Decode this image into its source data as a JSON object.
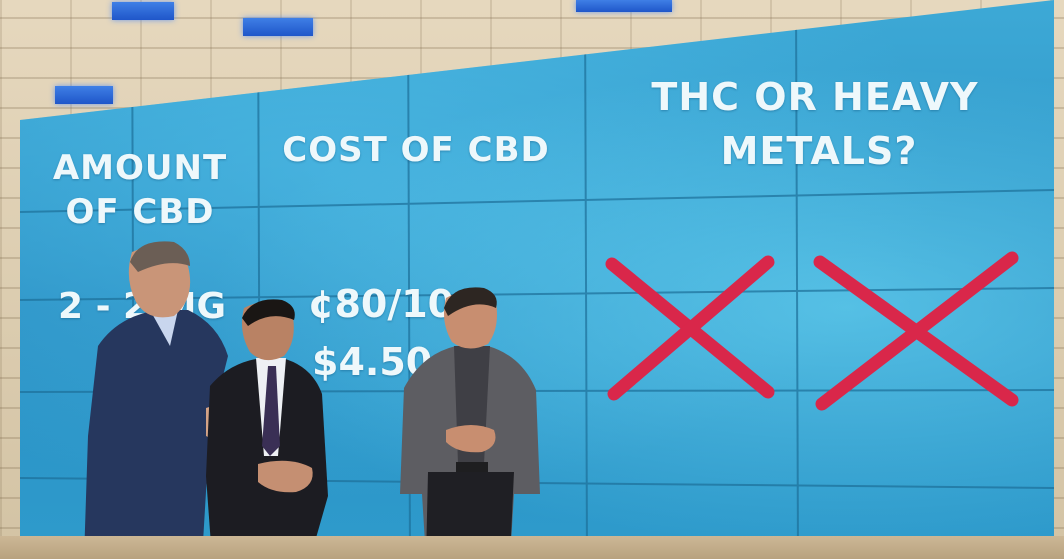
{
  "screen": {
    "headers": {
      "amount": [
        "AMOUNT",
        "OF CBD"
      ],
      "cost": "COST OF CBD",
      "thc": [
        "THC OR HEAVY",
        "METALS?"
      ]
    },
    "values": {
      "amount": "2 - 2 MG",
      "cost_line1": "¢80/10 -",
      "cost_line2": "$4.50"
    },
    "marks": [
      "x-mark",
      "x-mark"
    ],
    "colors": {
      "screen": "#3da9d6",
      "x_mark": "#d9274a",
      "text": "#eef8fb"
    }
  }
}
